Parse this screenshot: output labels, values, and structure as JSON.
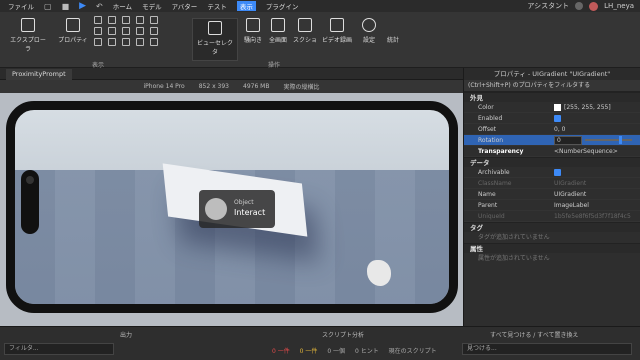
{
  "menubar": {
    "items": [
      "ファイル",
      "ホーム",
      "モデル",
      "アバター",
      "テスト",
      "表示",
      "プラグイン"
    ],
    "active_index": 5,
    "assistant": "アシスタント",
    "user": "LH_neya"
  },
  "ribbon": {
    "explorer": "エクスプローラ",
    "properties": "プロパティ",
    "viewselector": "ビューセレクタ",
    "facing": "騒向き",
    "fullscreen": "全画面",
    "screenshot": "スクショ",
    "video": "ビデオ録画",
    "settings": "設定",
    "stats": "統計",
    "group_view": "表示",
    "group_ops": "操作"
  },
  "tab": {
    "label": "ProximityPrompt"
  },
  "devbar": {
    "device": "iPhone 14 Pro",
    "resolution": "852 x 393",
    "memory": "4976 MB",
    "scale": "実際の縦横比"
  },
  "prompt": {
    "object": "Object",
    "action": "Interact"
  },
  "properties": {
    "title": "プロパティ - UIGradient \"UIGradient\"",
    "filter": "(Ctrl+Shift+P) のプロパティをフィルタする",
    "appearance": "外見",
    "color_label": "Color",
    "color_value": "[255, 255, 255]",
    "enabled_label": "Enabled",
    "offset_label": "Offset",
    "offset_value": "0, 0",
    "rotation_label": "Rotation",
    "rotation_value": "0",
    "transparency_label": "Transparency",
    "transparency_value": "<NumberSequence>",
    "data": "データ",
    "archivable_label": "Archivable",
    "classname_label": "ClassName",
    "classname_value": "UIGradient",
    "name_label": "Name",
    "name_value": "UIGradient",
    "parent_label": "Parent",
    "parent_value": "ImageLabel",
    "uniqueid_label": "UniqueId",
    "uniqueid_value": "1b5fe5e8f6f5d3f7f18f4c5",
    "tags": "タグ",
    "tags_empty": "タグが追加されていません",
    "attributes": "属性",
    "attributes_empty": "属性が追加されていません"
  },
  "bottom": {
    "output": "出力",
    "script_analysis": "スクリプト分析",
    "find_all": "すべて見つける / すべて置き換え",
    "filter": "フィルタ...",
    "errors": "0 一件",
    "warnings": "0 一件",
    "infos": "0 一個",
    "hints": "0 ヒント",
    "current_script": "現在のスクリプト",
    "find": "見つける..."
  }
}
